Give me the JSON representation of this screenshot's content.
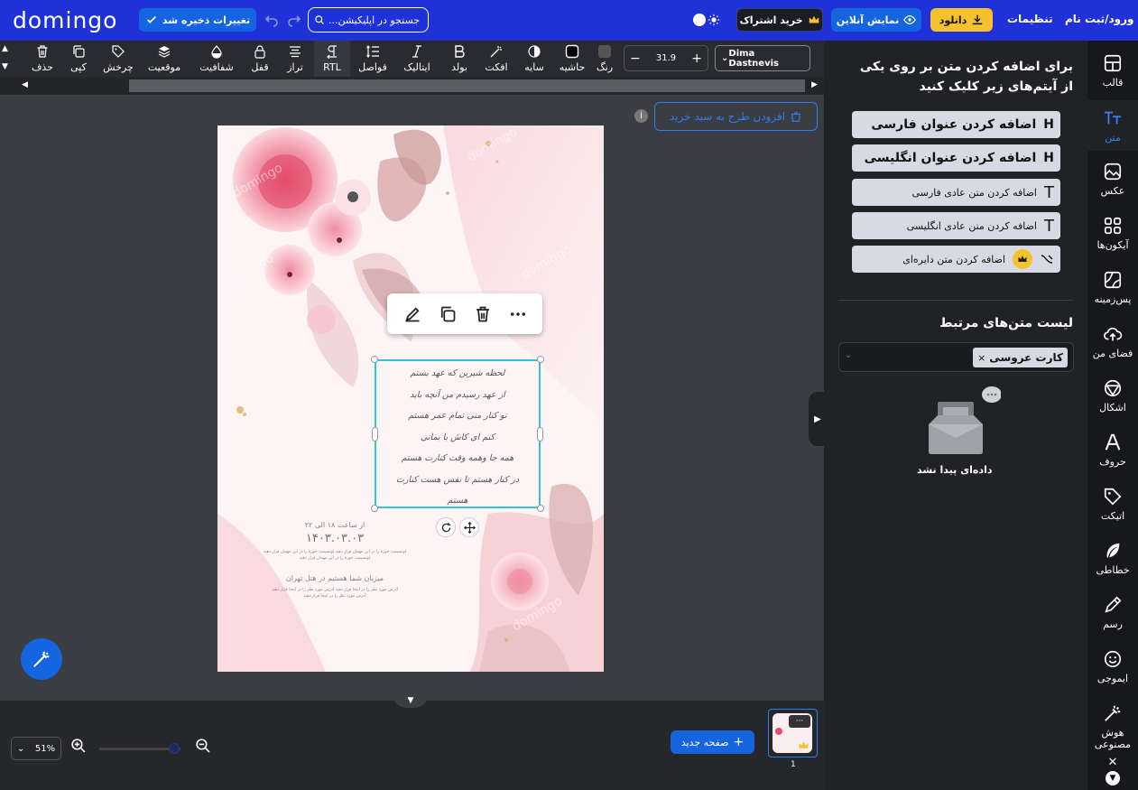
{
  "header": {
    "logo": "domingo",
    "save_status": "تغییرات ذخیره شد",
    "search_placeholder": "جستجو در اپلیکیشن...",
    "subscribe": "خرید اشتراک",
    "preview": "نمایش آنلاین",
    "download": "دانلود",
    "settings": "تنظیمات",
    "login": "ورود/ثبت نام"
  },
  "toolbar": {
    "delete": "حذف",
    "copy": "کپی",
    "rotate": "چرخش",
    "position": "موقعیت",
    "opacity": "شفافیت",
    "lock": "قفل",
    "align": "تراز",
    "rtl": "RTL",
    "spacing": "فواصل",
    "italic": "ایتالیک",
    "bold": "بولد",
    "effect": "افکت",
    "shadow": "سایه",
    "border": "حاشیه",
    "color": "رنگ",
    "font_size": "31.9",
    "font_name": "Dima Dastnevis"
  },
  "canvas": {
    "add_to_cart": "افزودن طرح به سبد خرید",
    "watermark": "domingo",
    "card_lines": [
      "لحظه شیرین که عهد بستم",
      "از عهد رسیدم من آنچه باید",
      "تو کنار منی تمام عمر هستم",
      "کنم ای کاش با بمانی",
      "همه جا وهمه وقت کنارت هستم",
      "در کنار هستم تا نفس هست کنارت",
      "هستم"
    ],
    "time_line": "از ساعت ۱۸ الی ۲۲",
    "date": "۱۴۰۳.۰۳.۰۳",
    "body_line1": "لوتسیمت حوره را در این مهمان قرار دهید لوتسیمت حوره را در این مهمان قرار دهید",
    "body_line2": "لوتسیمت حوره را در این مهمان قرار دهید",
    "host_line": "میزبان شما هستیم در هتل تهران",
    "footer_line1": "آدرس مورد نظر را در اینجا قرار دهید آدرس مورد نظر را در اینجا قرار دهید",
    "footer_line2": "آدرس مورد نظر را در اینجا قرار دهید"
  },
  "bottom": {
    "zoom": "51%",
    "new_page": "صفحه جدید",
    "page_number": "1"
  },
  "panel": {
    "instruction": "برای اضافه کردن متن بر روی یکی از آیتم‌های زیر کلیک کنید",
    "add_fa_title": "اضافه کردن عنوان فارسی",
    "add_en_title": "اضافه کردن عنوان انگلیسی",
    "add_fa_text": "اضافه کردن متن عادی فارسی",
    "add_en_text": "اضافه کردن متن عادی انگلیسی",
    "add_circle_text": "اضافه کردن متن دایره‌ای",
    "related_title": "لیست متن‌های مرتبط",
    "tag": "کارت عروسی",
    "empty": "داده‌ای پیدا نشد"
  },
  "sidenav": [
    "قالب",
    "متن",
    "عکس",
    "آیکون‌ها",
    "پس‌زمینه",
    "فضای من",
    "اشکال",
    "حروف",
    "اتیکت",
    "خطاطی",
    "رسم",
    "ایموجی",
    "هوش مصنوعی"
  ],
  "colors": {
    "brand": "#1e32d8",
    "accent_yellow": "#f5c12e",
    "selection": "#33c3d6",
    "button_blue": "#1565e0"
  }
}
